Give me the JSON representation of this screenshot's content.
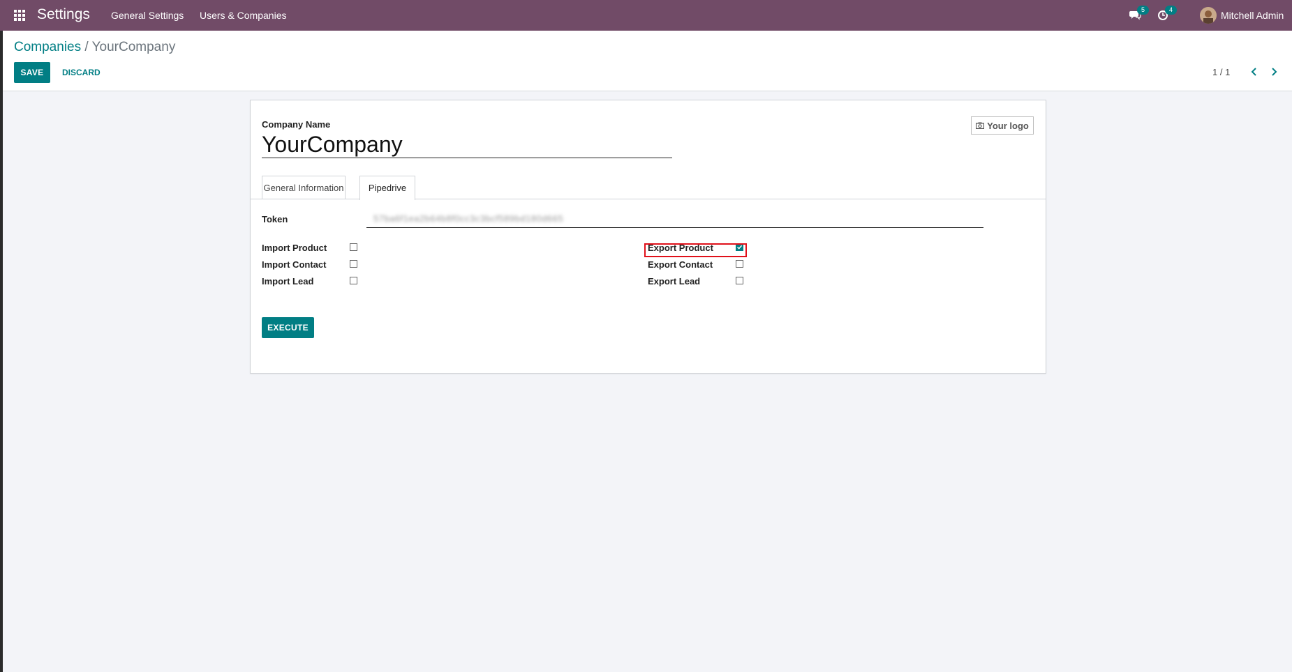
{
  "navbar": {
    "app_title": "Settings",
    "menus": [
      "General Settings",
      "Users & Companies"
    ],
    "messages_count": "5",
    "activities_count": "4",
    "user_name": "Mitchell Admin",
    "bg_color": "#714b67"
  },
  "control_panel": {
    "breadcrumb_parent": "Companies",
    "breadcrumb_separator": "/",
    "breadcrumb_current": "YourCompany",
    "save_label": "SAVE",
    "discard_label": "DISCARD",
    "pager": "1 / 1"
  },
  "form": {
    "company_name_label": "Company Name",
    "company_name": "YourCompany",
    "logo_label": "Your logo",
    "tabs": [
      "General Information",
      "Pipedrive"
    ],
    "active_tab": "Pipedrive",
    "token_label": "Token",
    "token_value": "57ba6f1ea2b64b8f0cc3c3bcf589bd180d665",
    "options_left": [
      {
        "label": "Import Product",
        "checked": false
      },
      {
        "label": "Import Contact",
        "checked": false
      },
      {
        "label": "Import Lead",
        "checked": false
      }
    ],
    "options_right": [
      {
        "label": "Export Product",
        "checked": true
      },
      {
        "label": "Export Contact",
        "checked": false
      },
      {
        "label": "Export Lead",
        "checked": false
      }
    ],
    "execute_label": "EXECUTE"
  },
  "colors": {
    "primary": "#017e84",
    "highlight": "#e0101a"
  }
}
